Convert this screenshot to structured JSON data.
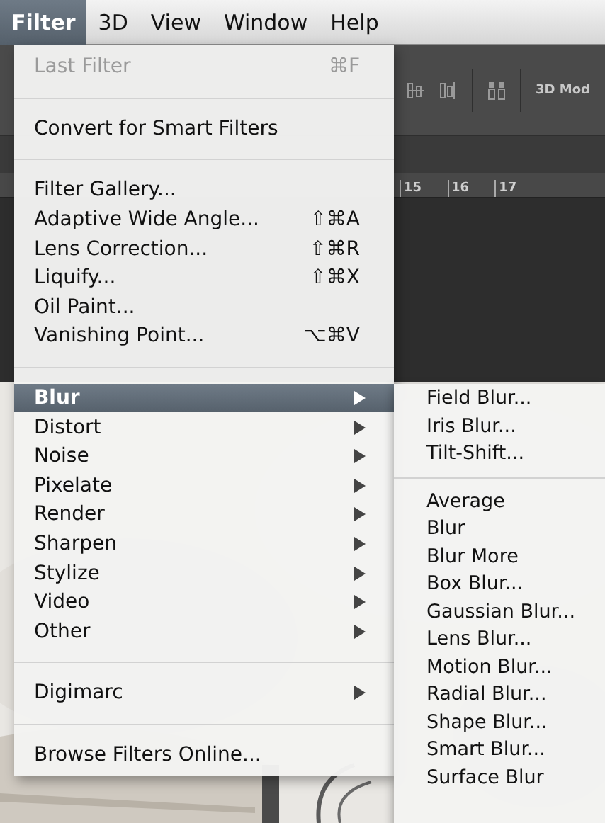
{
  "menubar": [
    {
      "label": "Filter",
      "selected": true
    },
    {
      "label": "3D",
      "selected": false
    },
    {
      "label": "View",
      "selected": false
    },
    {
      "label": "Window",
      "selected": false
    },
    {
      "label": "Help",
      "selected": false
    }
  ],
  "toolbar": {
    "label": "3D Mod"
  },
  "ruler": {
    "ticks": [
      "15",
      "16",
      "17"
    ]
  },
  "menu": {
    "items": [
      {
        "kind": "item",
        "label": "Last Filter",
        "shortcut": "⌘F",
        "disabled": true,
        "submenu": false,
        "selected": false
      },
      {
        "kind": "separator"
      },
      {
        "kind": "item",
        "label": "Convert for Smart Filters",
        "disabled": false,
        "submenu": false,
        "selected": false
      },
      {
        "kind": "separator"
      },
      {
        "kind": "item",
        "label": "Filter Gallery...",
        "disabled": false,
        "submenu": false,
        "selected": false
      },
      {
        "kind": "item",
        "label": "Adaptive Wide Angle...",
        "shortcut": "⇧⌘A",
        "disabled": false,
        "submenu": false,
        "selected": false
      },
      {
        "kind": "item",
        "label": "Lens Correction...",
        "shortcut": "⇧⌘R",
        "disabled": false,
        "submenu": false,
        "selected": false
      },
      {
        "kind": "item",
        "label": "Liquify...",
        "shortcut": "⇧⌘X",
        "disabled": false,
        "submenu": false,
        "selected": false
      },
      {
        "kind": "item",
        "label": "Oil Paint...",
        "disabled": false,
        "submenu": false,
        "selected": false
      },
      {
        "kind": "item",
        "label": "Vanishing Point...",
        "shortcut": "⌥⌘V",
        "disabled": false,
        "submenu": false,
        "selected": false
      },
      {
        "kind": "separator"
      },
      {
        "kind": "item",
        "label": "Blur",
        "disabled": false,
        "submenu": true,
        "selected": true
      },
      {
        "kind": "item",
        "label": "Distort",
        "disabled": false,
        "submenu": true,
        "selected": false
      },
      {
        "kind": "item",
        "label": "Noise",
        "disabled": false,
        "submenu": true,
        "selected": false
      },
      {
        "kind": "item",
        "label": "Pixelate",
        "disabled": false,
        "submenu": true,
        "selected": false
      },
      {
        "kind": "item",
        "label": "Render",
        "disabled": false,
        "submenu": true,
        "selected": false
      },
      {
        "kind": "item",
        "label": "Sharpen",
        "disabled": false,
        "submenu": true,
        "selected": false
      },
      {
        "kind": "item",
        "label": "Stylize",
        "disabled": false,
        "submenu": true,
        "selected": false
      },
      {
        "kind": "item",
        "label": "Video",
        "disabled": false,
        "submenu": true,
        "selected": false
      },
      {
        "kind": "item",
        "label": "Other",
        "disabled": false,
        "submenu": true,
        "selected": false
      },
      {
        "kind": "separator"
      },
      {
        "kind": "item",
        "label": "Digimarc",
        "disabled": false,
        "submenu": true,
        "selected": false
      },
      {
        "kind": "separator"
      },
      {
        "kind": "item",
        "label": "Browse Filters Online...",
        "disabled": false,
        "submenu": false,
        "selected": false
      }
    ]
  },
  "submenu": {
    "items": [
      {
        "kind": "item",
        "label": "Field Blur..."
      },
      {
        "kind": "item",
        "label": "Iris Blur..."
      },
      {
        "kind": "item",
        "label": "Tilt-Shift..."
      },
      {
        "kind": "separator"
      },
      {
        "kind": "item",
        "label": "Average"
      },
      {
        "kind": "item",
        "label": "Blur"
      },
      {
        "kind": "item",
        "label": "Blur More"
      },
      {
        "kind": "item",
        "label": "Box Blur..."
      },
      {
        "kind": "item",
        "label": "Gaussian Blur..."
      },
      {
        "kind": "item",
        "label": "Lens Blur..."
      },
      {
        "kind": "item",
        "label": "Motion Blur..."
      },
      {
        "kind": "item",
        "label": "Radial Blur..."
      },
      {
        "kind": "item",
        "label": "Shape Blur..."
      },
      {
        "kind": "item",
        "label": "Smart Blur..."
      },
      {
        "kind": "item",
        "label": "Surface Blur"
      }
    ]
  }
}
